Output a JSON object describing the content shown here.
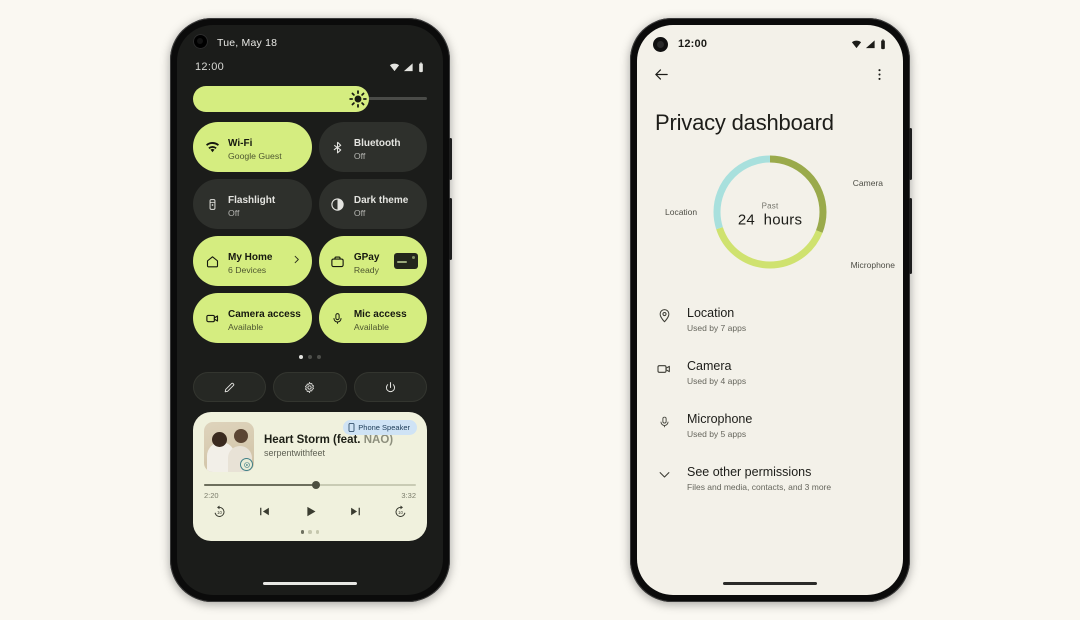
{
  "page": {
    "background_color": "#faf8f2",
    "accent_green": "#d5ed80",
    "dark_surface": "#2e302c"
  },
  "left_phone": {
    "name": "quick-settings-panel",
    "status_bar": {
      "date": "Tue, May 18",
      "time": "12:00",
      "icons": [
        "wifi-icon",
        "cellular-signal-icon",
        "battery-icon"
      ]
    },
    "brightness_slider": {
      "label": "Brightness",
      "value_percent": 75,
      "icon": "brightness-icon"
    },
    "tiles": [
      {
        "title": "Wi-Fi",
        "subtitle": "Google Guest",
        "icon": "wifi-icon",
        "state": "active"
      },
      {
        "title": "Bluetooth",
        "subtitle": "Off",
        "icon": "bluetooth-icon",
        "state": "inactive"
      },
      {
        "title": "Flashlight",
        "subtitle": "Off",
        "icon": "flashlight-icon",
        "state": "inactive"
      },
      {
        "title": "Dark theme",
        "subtitle": "Off",
        "icon": "dark-theme-icon",
        "state": "inactive"
      },
      {
        "title": "My Home",
        "subtitle": "6 Devices",
        "icon": "home-icon",
        "state": "active",
        "trailing": "chevron-right-icon"
      },
      {
        "title": "GPay",
        "subtitle": "Ready",
        "icon": "wallet-icon",
        "state": "active",
        "trailing": "payment-card"
      },
      {
        "title": "Camera access",
        "subtitle": "Available",
        "icon": "camera-icon",
        "state": "active"
      },
      {
        "title": "Mic access",
        "subtitle": "Available",
        "icon": "microphone-icon",
        "state": "active"
      }
    ],
    "page_dots": {
      "count": 3,
      "active_index": 0
    },
    "controls": [
      {
        "name": "edit-tiles-button",
        "icon": "pencil-icon"
      },
      {
        "name": "settings-button",
        "icon": "gear-icon"
      },
      {
        "name": "power-button",
        "icon": "power-icon"
      }
    ],
    "media_player": {
      "output_chip": {
        "label": "Phone Speaker",
        "icon": "phone-icon"
      },
      "title_main": "Heart Storm (feat.",
      "title_feat": "NAO)",
      "artist": "serpentwithfeet",
      "album_art_badge": "app-badge-icon",
      "elapsed": "2:20",
      "duration": "3:32",
      "progress_percent": 53,
      "transport": [
        {
          "name": "rewind-10-button",
          "icon": "replay-10-icon",
          "label": "10"
        },
        {
          "name": "previous-track-button",
          "icon": "skip-previous-icon"
        },
        {
          "name": "play-button",
          "icon": "play-icon"
        },
        {
          "name": "next-track-button",
          "icon": "skip-next-icon"
        },
        {
          "name": "forward-10-button",
          "icon": "forward-10-icon",
          "label": "10"
        }
      ],
      "page_dots": {
        "count": 3,
        "active_index": 0
      }
    }
  },
  "right_phone": {
    "name": "privacy-dashboard-screen",
    "status_bar": {
      "time": "12:00",
      "icons": [
        "wifi-icon",
        "cellular-signal-icon",
        "battery-icon"
      ]
    },
    "app_bar": {
      "back": "back-arrow-icon",
      "overflow": "more-options-icon"
    },
    "title": "Privacy dashboard",
    "chart_data": {
      "type": "pie",
      "title": "Past 24 hours",
      "center_label_top": "Past",
      "center_label_value": "24",
      "center_label_unit": "hours",
      "categories": [
        "Camera",
        "Microphone",
        "Location"
      ],
      "values": [
        31,
        39,
        30
      ],
      "colors": [
        "#9aaa4b",
        "#cfe26f",
        "#a8e0dd"
      ],
      "legend_position": "around-donut",
      "labels": [
        {
          "text": "Camera",
          "color": "#9aaa4b"
        },
        {
          "text": "Microphone",
          "color": "#cfe26f"
        },
        {
          "text": "Location",
          "color": "#a8e0dd"
        }
      ]
    },
    "permissions": [
      {
        "name": "Location",
        "sub": "Used by 7 apps",
        "icon": "location-pin-icon"
      },
      {
        "name": "Camera",
        "sub": "Used by 4 apps",
        "icon": "camera-icon"
      },
      {
        "name": "Microphone",
        "sub": "Used by 5 apps",
        "icon": "microphone-icon"
      },
      {
        "name": "See other permissions",
        "sub": "Files and media, contacts, and 3 more",
        "icon": "chevron-down-icon"
      }
    ]
  }
}
